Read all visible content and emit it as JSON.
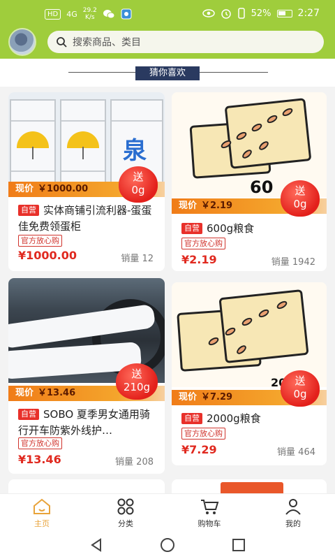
{
  "status_bar": {
    "sim": "HD",
    "signal": "4G",
    "speed_value": "29.2",
    "speed_unit": "K/s",
    "battery": "52%",
    "time": "2:27"
  },
  "search": {
    "placeholder": "搜索商品、类目"
  },
  "section_title": "猜你喜欢",
  "products": [
    {
      "price_strip_label": "现价",
      "price_strip_value": "￥1000.00",
      "gift_label": "送",
      "gift_value": "0g",
      "tag": "自营",
      "name": "实体商铺引流利器-蛋蛋佳免费领蛋柜",
      "badge": "官方放心购",
      "price": "¥1000.00",
      "sold": "销量 12"
    },
    {
      "price_strip_label": "现价",
      "price_strip_value": "￥2.19",
      "gift_label": "送",
      "gift_value": "0g",
      "image_text": "60",
      "tag": "自营",
      "name": "600g粮食",
      "badge": "官方放心购",
      "price": "¥2.19",
      "sold": "销量 1942"
    },
    {
      "price_strip_label": "现价",
      "price_strip_value": "￥13.46",
      "gift_label": "送",
      "gift_value": "210g",
      "tag": "自营",
      "name": "SOBO 夏季男女通用骑行开车防紫外线护…",
      "badge": "官方放心购",
      "price": "¥13.46",
      "sold": "销量 208"
    },
    {
      "price_strip_label": "现价",
      "price_strip_value": "￥7.29",
      "gift_label": "送",
      "gift_value": "0g",
      "image_text": "20",
      "tag": "自营",
      "name": "2000g粮食",
      "badge": "官方放心购",
      "price": "¥7.29",
      "sold": "销量 464"
    }
  ],
  "tabbar": [
    {
      "label": "主页",
      "icon": "home-icon",
      "active": true
    },
    {
      "label": "分类",
      "icon": "category-icon",
      "active": false
    },
    {
      "label": "购物车",
      "icon": "cart-icon",
      "active": false
    },
    {
      "label": "我的",
      "icon": "user-icon",
      "active": false
    }
  ],
  "colors": {
    "header_green": "#9fcd3c",
    "accent_red": "#e0291f",
    "active_tab": "#e8a33a",
    "price_strip": "#f07c18"
  }
}
